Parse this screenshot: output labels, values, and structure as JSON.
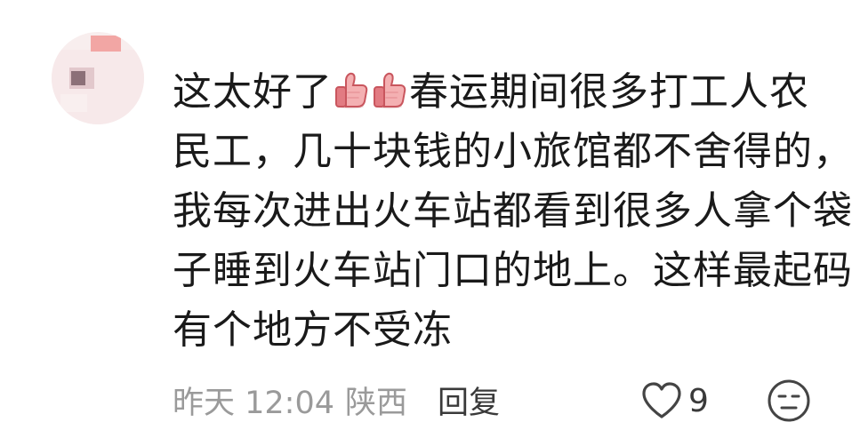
{
  "comment": {
    "lines": [
      "这太好了",
      "春运期间很多打工人农",
      "民工，几十块钱的小旅馆都不舍得的，",
      "我每次进出火车站都看到很多人拿个袋",
      "子睡到火车站门口的地上。这样最起码",
      "有个地方不受冻"
    ],
    "emoji_icons": [
      "thumbs-up-icon",
      "thumbs-up-icon"
    ]
  },
  "meta": {
    "time": "昨天 12:04",
    "location": "陕西",
    "reply_label": "回复",
    "like_count": "9",
    "like_icon": "heart-outline-icon",
    "emoji_icon": "expressionless-face-icon"
  }
}
